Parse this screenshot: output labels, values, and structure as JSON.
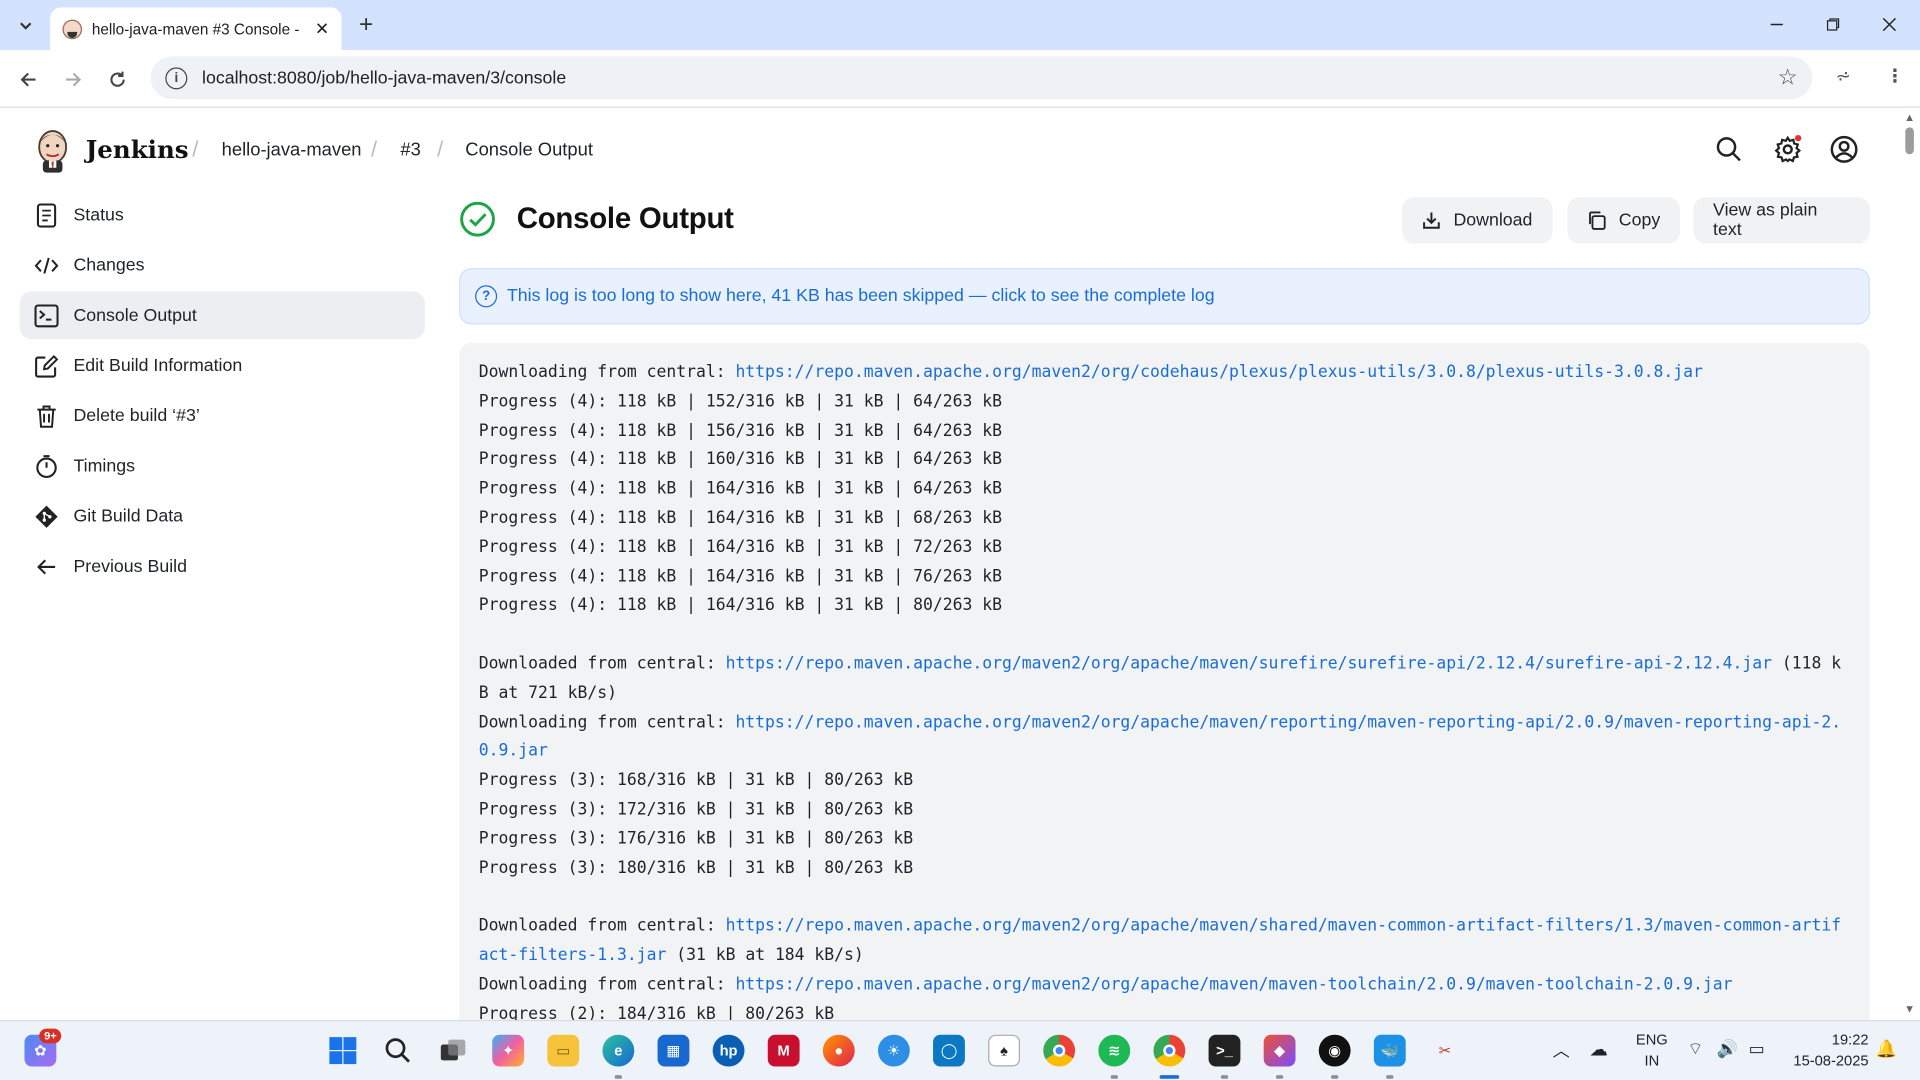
{
  "browser": {
    "tab_title": "hello-java-maven #3 Console -",
    "url": "localhost:8080/job/hello-java-maven/3/console"
  },
  "header": {
    "brand": "Jenkins",
    "breadcrumbs": [
      "hello-java-maven",
      "#3",
      "Console Output"
    ]
  },
  "sidebar": {
    "items": [
      {
        "label": "Status",
        "icon": "document-icon"
      },
      {
        "label": "Changes",
        "icon": "code-icon"
      },
      {
        "label": "Console Output",
        "icon": "terminal-icon",
        "active": true
      },
      {
        "label": "Edit Build Information",
        "icon": "edit-icon"
      },
      {
        "label": "Delete build ‘#3’",
        "icon": "trash-icon"
      },
      {
        "label": "Timings",
        "icon": "stopwatch-icon"
      },
      {
        "label": "Git Build Data",
        "icon": "git-icon"
      },
      {
        "label": "Previous Build",
        "icon": "arrow-left-icon"
      }
    ]
  },
  "main": {
    "title": "Console Output",
    "status": "success",
    "buttons": {
      "download": "Download",
      "copy": "Copy",
      "plain": "View as plain text"
    },
    "notice": "This log is too long to show here, 41 KB has been skipped — click to see the complete log"
  },
  "console": {
    "lines": [
      {
        "prefix": "Downloading from central: ",
        "link": "https://repo.maven.apache.org/maven2/org/codehaus/plexus/plexus-utils/3.0.8/plexus-utils-3.0.8.jar",
        "suffix": ""
      },
      {
        "text": "Progress (4): 118 kB | 152/316 kB | 31 kB | 64/263 kB"
      },
      {
        "text": "Progress (4): 118 kB | 156/316 kB | 31 kB | 64/263 kB"
      },
      {
        "text": "Progress (4): 118 kB | 160/316 kB | 31 kB | 64/263 kB"
      },
      {
        "text": "Progress (4): 118 kB | 164/316 kB | 31 kB | 64/263 kB"
      },
      {
        "text": "Progress (4): 118 kB | 164/316 kB | 31 kB | 68/263 kB"
      },
      {
        "text": "Progress (4): 118 kB | 164/316 kB | 31 kB | 72/263 kB"
      },
      {
        "text": "Progress (4): 118 kB | 164/316 kB | 31 kB | 76/263 kB"
      },
      {
        "text": "Progress (4): 118 kB | 164/316 kB | 31 kB | 80/263 kB"
      },
      {
        "blank": true
      },
      {
        "prefix": "Downloaded from central: ",
        "link": "https://repo.maven.apache.org/maven2/org/apache/maven/surefire/surefire-api/2.12.4/surefire-api-2.12.4.jar",
        "suffix": " (118 kB at 721 kB/s)"
      },
      {
        "prefix": "Downloading from central: ",
        "link": "https://repo.maven.apache.org/maven2/org/apache/maven/reporting/maven-reporting-api/2.0.9/maven-reporting-api-2.0.9.jar",
        "suffix": ""
      },
      {
        "text": "Progress (3): 168/316 kB | 31 kB | 80/263 kB"
      },
      {
        "text": "Progress (3): 172/316 kB | 31 kB | 80/263 kB"
      },
      {
        "text": "Progress (3): 176/316 kB | 31 kB | 80/263 kB"
      },
      {
        "text": "Progress (3): 180/316 kB | 31 kB | 80/263 kB"
      },
      {
        "blank": true
      },
      {
        "prefix": "Downloaded from central: ",
        "link": "https://repo.maven.apache.org/maven2/org/apache/maven/shared/maven-common-artifact-filters/1.3/maven-common-artifact-filters-1.3.jar",
        "suffix": " (31 kB at 184 kB/s)"
      },
      {
        "prefix": "Downloading from central: ",
        "link": "https://repo.maven.apache.org/maven2/org/apache/maven/maven-toolchain/2.0.9/maven-toolchain-2.0.9.jar",
        "suffix": ""
      },
      {
        "text": "Progress (2): 184/316 kB | 80/263 kB"
      }
    ]
  },
  "taskbar": {
    "notification_badge": "9+",
    "apps": [
      "widgets",
      "start",
      "search",
      "task-view",
      "copilot",
      "file-explorer",
      "edge",
      "store",
      "hp",
      "mcafee",
      "firefox",
      "weather",
      "app-blue",
      "solitaire",
      "chrome",
      "spotify",
      "chrome-active",
      "terminal",
      "git-app",
      "github",
      "docker",
      "snipping"
    ],
    "lang_line1": "ENG",
    "lang_line2": "IN",
    "time": "19:22",
    "date": "15-08-2025"
  }
}
